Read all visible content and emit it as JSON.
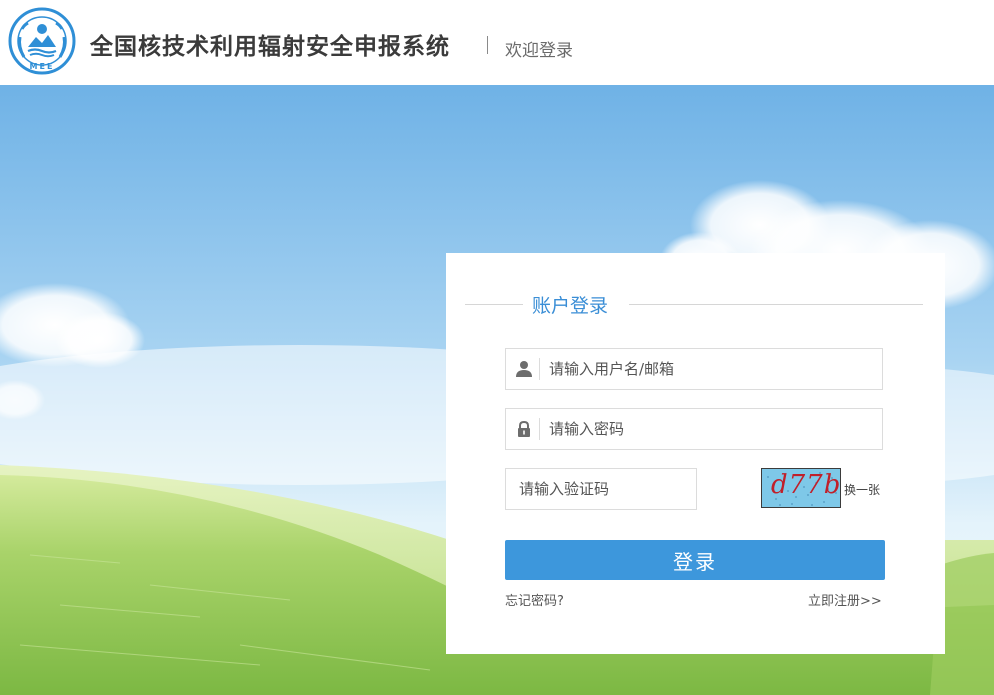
{
  "header": {
    "logo_text": "MEE",
    "title": "全国核技术利用辐射安全申报系统",
    "subtitle": "欢迎登录"
  },
  "login": {
    "heading": "账户登录",
    "username_placeholder": "请输入用户名/邮箱",
    "password_placeholder": "请输入密码",
    "captcha_placeholder": "请输入验证码",
    "captcha_text": "d77b",
    "refresh_label": "换一张",
    "submit_label": "登录",
    "forgot_label": "忘记密码?",
    "register_label": "立即注册>>"
  },
  "icons": {
    "user": "user-icon",
    "lock": "lock-icon",
    "logo": "mee-logo"
  },
  "colors": {
    "accent": "#3d97dc",
    "heading": "#3a8ed6",
    "sky": "#8fc3ea",
    "grass": "#9ccc5e"
  }
}
